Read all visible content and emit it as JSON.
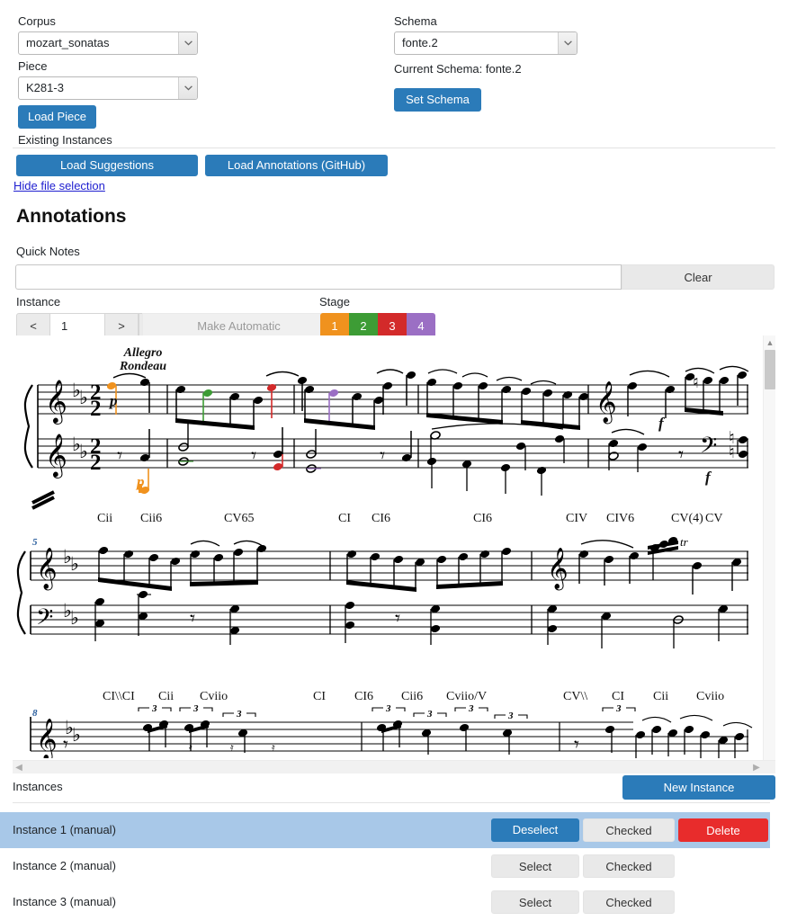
{
  "file_selection": {
    "corpus_label": "Corpus",
    "corpus_value": "mozart_sonatas",
    "piece_label": "Piece",
    "piece_value": "K281-3",
    "load_piece_label": "Load Piece",
    "existing_instances_label": "Existing Instances",
    "load_suggestions_label": "Load Suggestions",
    "load_annotations_label": "Load Annotations (GitHub)",
    "hide_file_selection_label": "Hide file selection",
    "schema_label": "Schema",
    "schema_value": "fonte.2",
    "current_schema_text": "Current Schema: fonte.2",
    "set_schema_label": "Set Schema"
  },
  "annotations": {
    "heading": "Annotations",
    "quick_notes_label": "Quick Notes",
    "quick_notes_value": "",
    "quick_notes_placeholder": "",
    "clear_label": "Clear",
    "instance_label": "Instance",
    "prev_label": "<",
    "instance_number": "1",
    "next_label": ">",
    "confirm_label": "✓",
    "make_automatic_label": "Make Automatic",
    "stage_label": "Stage",
    "stages": [
      {
        "label": "1",
        "color": "#f0921e"
      },
      {
        "label": "2",
        "color": "#3d9c35"
      },
      {
        "label": "3",
        "color": "#d32a2a"
      },
      {
        "label": "4",
        "color": "#9b6fc4"
      }
    ]
  },
  "score": {
    "tempo_line1": "Allegro",
    "tempo_line2": "Rondeau",
    "dynamics": [
      "p",
      "p",
      "f",
      "f"
    ],
    "measure_numbers": [
      "5",
      "8"
    ],
    "chord_rows": [
      {
        "labels": [
          "Cii",
          "Cii6",
          "CV65",
          "CI",
          "CI6",
          "CI6",
          "CIV",
          "CIV6",
          "CV(4)",
          "CV"
        ]
      },
      {
        "labels": [
          "CI\\\\CI",
          "Cii",
          "Cviio",
          "CI",
          "CI6",
          "Cii6",
          "Cviio/V",
          "CV\\\\",
          "CI",
          "Cii",
          "Cviio"
        ]
      }
    ],
    "annotation_colors": [
      "#f0921e",
      "#3d9c35",
      "#d32a2a",
      "#9b6fc4"
    ]
  },
  "instances_panel": {
    "title": "Instances",
    "new_instance_label": "New Instance",
    "rows": [
      {
        "name": "Instance 1 (manual)",
        "select_label": "Deselect",
        "checked_label": "Checked",
        "delete_label": "Delete",
        "selected": true
      },
      {
        "name": "Instance 2 (manual)",
        "select_label": "Select",
        "checked_label": "Checked",
        "delete_label": "",
        "selected": false
      },
      {
        "name": "Instance 3 (manual)",
        "select_label": "Select",
        "checked_label": "Checked",
        "delete_label": "",
        "selected": false
      }
    ]
  },
  "theme": {
    "primary": "#2b7bb9",
    "danger": "#e82c2c",
    "selected_row": "#a8c8e8"
  }
}
